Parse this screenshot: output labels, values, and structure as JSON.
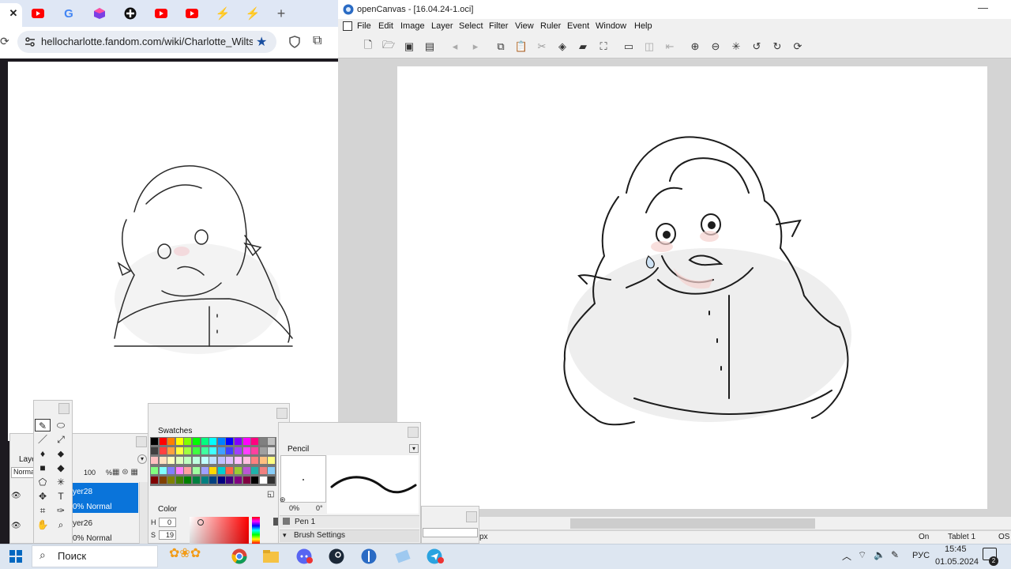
{
  "browser": {
    "tabs": [
      {
        "icon": "close-icon",
        "glyph": "✕",
        "color": "#111111"
      },
      {
        "icon": "youtube-icon",
        "color": "#ff0000"
      },
      {
        "icon": "google-icon",
        "glyph": "G",
        "color": "#4285f4"
      },
      {
        "icon": "cube-extension-icon",
        "color": "#7b3fe4"
      },
      {
        "icon": "plus-circle-icon",
        "glyph": "✚",
        "color": "#111111"
      },
      {
        "icon": "youtube-icon",
        "color": "#ff0000"
      },
      {
        "icon": "youtube-icon",
        "color": "#ff0000"
      },
      {
        "icon": "lightning-icon",
        "glyph": "⚡",
        "color": "#f47c20"
      },
      {
        "icon": "lightning-icon",
        "glyph": "⚡",
        "color": "#f47c20"
      }
    ],
    "new_tab_glyph": "+",
    "url": "hellocharlotte.fandom.com/wiki/Charlotte_Wiltshi...",
    "colors": {
      "accent": "#1a73e8",
      "tab_strip": "#dfe7f5"
    }
  },
  "opencanvas": {
    "title": "openCanvas - [16.04.24-1.oci]",
    "window_controls": {
      "minimize": "—"
    },
    "menu": [
      "File",
      "Edit",
      "Image",
      "Layer",
      "Select",
      "Filter",
      "View",
      "Ruler",
      "Event",
      "Window",
      "Help"
    ],
    "toolbar_icons": [
      "new-file-icon",
      "open-file-icon",
      "save-icon",
      "save-all-icon",
      "prev-icon",
      "next-icon",
      "copy-icon",
      "paste-icon",
      "cut-icon",
      "stamp-icon",
      "eraser-icon",
      "transform-icon",
      "select-rect-icon",
      "select-clear-icon",
      "deselect-icon",
      "zoom-in-icon",
      "zoom-out-icon",
      "fit-icon",
      "rotate-left-icon",
      "rotate-right-icon",
      "rotate-reset-icon"
    ],
    "status": {
      "unit": "px",
      "on": "On",
      "tablet": "Tablet 1",
      "os": "OS"
    }
  },
  "layers_panel": {
    "tab": "Laye",
    "mode": "Norma",
    "opacity": "100",
    "percent": "%",
    "layers": [
      {
        "name": "yer28",
        "mode": "0% Normal",
        "selected": true
      },
      {
        "name": "yer26",
        "mode": "0% Normal",
        "selected": false
      }
    ]
  },
  "swatches_panel": {
    "tab": "Swatches",
    "colors": [
      "#000000",
      "#ff0000",
      "#ff8000",
      "#ffff00",
      "#80ff00",
      "#00ff00",
      "#00ff80",
      "#00ffff",
      "#0080ff",
      "#0000ff",
      "#8000ff",
      "#ff00ff",
      "#ff0080",
      "#808080",
      "#c0c0c0",
      "#404040",
      "#ff4040",
      "#ffa040",
      "#ffff40",
      "#a0ff40",
      "#40ff40",
      "#40ffa0",
      "#40ffff",
      "#40a0ff",
      "#4040ff",
      "#a040ff",
      "#ff40ff",
      "#ff40a0",
      "#a0a0a0",
      "#e0e0e0",
      "#ffc0c0",
      "#ffe0c0",
      "#ffffc0",
      "#e0ffc0",
      "#c0ffc0",
      "#c0ffe0",
      "#c0ffff",
      "#c0e0ff",
      "#c0c0ff",
      "#e0c0ff",
      "#ffc0ff",
      "#ffc0e0",
      "#ff8080",
      "#ffc080",
      "#ffff80",
      "#80ff80",
      "#80ffff",
      "#8080ff",
      "#ff80ff",
      "#ffa0a0",
      "#a0ffa0",
      "#a0a0ff",
      "#ffd700",
      "#00ced1",
      "#ff6347",
      "#9acd32",
      "#ba55d3",
      "#20b2aa",
      "#f08080",
      "#87cefa",
      "#800000",
      "#804000",
      "#808000",
      "#408000",
      "#008000",
      "#008040",
      "#008080",
      "#004080",
      "#000080",
      "#400080",
      "#800080",
      "#800040",
      "#000000",
      "#ffffff",
      "#303030"
    ],
    "color_tab": "Color",
    "h_label": "H",
    "h_value": "0",
    "s_label": "S",
    "s_value": "19"
  },
  "pencil_panel": {
    "tab": "Pencil",
    "size": "0%",
    "angle": "0°",
    "brush": "Pen 1",
    "settings": "Brush Settings"
  },
  "tool_palette": {
    "tools": [
      "pencil-tool-icon",
      "eraser-tool-icon",
      "brush-tool-icon",
      "airbrush-tool-icon",
      "fill-tool-icon",
      "blur-tool-icon",
      "rect-tool-icon",
      "shape-tool-icon",
      "lasso-tool-icon",
      "magic-wand-icon",
      "move-tool-icon",
      "text-tool-icon",
      "crop-tool-icon",
      "eyedropper-tool-icon",
      "hand-tool-icon",
      "zoom-tool-icon"
    ]
  },
  "taskbar": {
    "search_label": "Поиск",
    "lang": "РУС",
    "time": "15:45",
    "date": "01.05.2024",
    "notifications": "2",
    "apps": [
      "windows-icon",
      "chrome-icon",
      "file-explorer-icon",
      "discord-icon",
      "steam-icon",
      "opencanvas-icon",
      "drawing-app-icon",
      "telegram-icon"
    ]
  }
}
